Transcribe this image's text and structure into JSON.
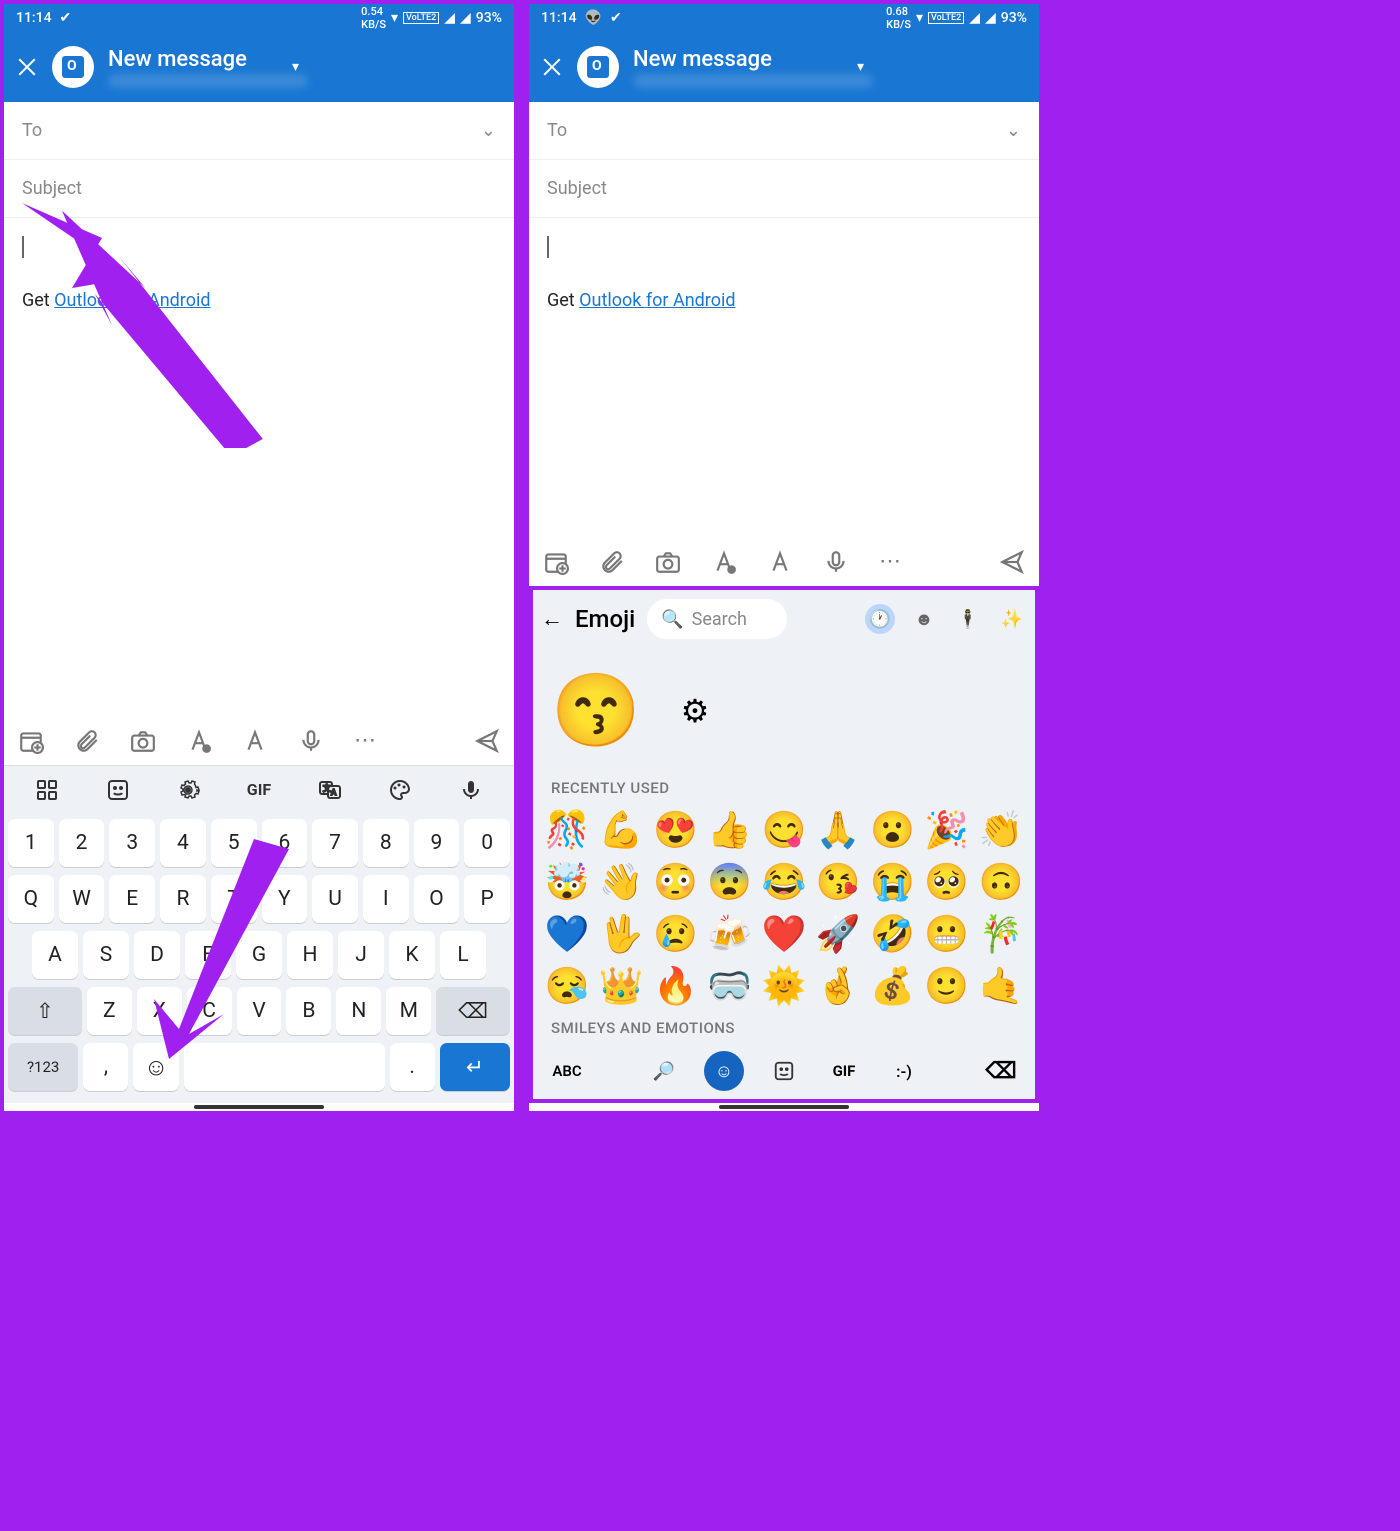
{
  "status": {
    "time": "11:14",
    "kbs_left": "0.54",
    "kbs_right": "0.68",
    "kbs_unit": "KB/S",
    "lte": "VoLTE2",
    "battery": "93%"
  },
  "header": {
    "title": "New message",
    "from_account": "(obscured email address)"
  },
  "fields": {
    "to_label": "To",
    "subject_label": "Subject"
  },
  "body": {
    "prefix": "Get ",
    "link_text": "Outlook for Android"
  },
  "compose_icons": [
    "calendar-add",
    "attachment",
    "camera",
    "font-color",
    "font",
    "mic",
    "more",
    "send"
  ],
  "keyboard": {
    "toolbar": [
      "apps",
      "sticker",
      "gear",
      "GIF",
      "translate",
      "palette",
      "mic"
    ],
    "row1": [
      "1",
      "2",
      "3",
      "4",
      "5",
      "6",
      "7",
      "8",
      "9",
      "0"
    ],
    "row2": [
      "Q",
      "W",
      "E",
      "R",
      "T",
      "Y",
      "U",
      "I",
      "O",
      "P"
    ],
    "row3": [
      "A",
      "S",
      "D",
      "F",
      "G",
      "H",
      "J",
      "K",
      "L"
    ],
    "row4_shift": "⇧",
    "row4": [
      "Z",
      "X",
      "C",
      "V",
      "B",
      "N",
      "M"
    ],
    "row4_back": "⌫",
    "row5_sym": "?123",
    "row5_comma": ",",
    "row5_emoji": "☺",
    "row5_period": ".",
    "row5_enter": "↵"
  },
  "emoji": {
    "title": "Emoji",
    "search_placeholder": "Search",
    "big_emoji": "😙",
    "section_recent": "RECENTLY USED",
    "recent": [
      "🎊",
      "💪",
      "😍",
      "👍",
      "😋",
      "🙏",
      "😮",
      "🎉",
      "👏",
      "🤯",
      "👋",
      "😳",
      "😨",
      "😂",
      "😘",
      "😭",
      "🥺",
      "🙃",
      "💙",
      "🖖",
      "😢",
      "🍻",
      "❤️",
      "🚀",
      "🤣",
      "😬",
      "🎋",
      "😪",
      "👑",
      "🔥",
      "🥽",
      "🌞",
      "🤞",
      "💰",
      "🙂",
      "🤙"
    ],
    "section_smileys": "SMILEYS AND EMOTIONS",
    "bottom": {
      "abc": "ABC",
      "gif": "GIF",
      "text": ":-)"
    }
  }
}
